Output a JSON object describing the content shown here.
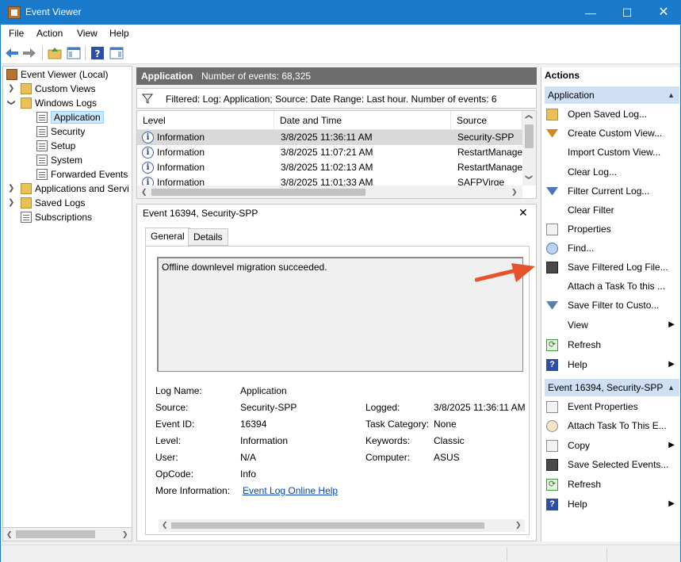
{
  "window": {
    "title": "Event Viewer"
  },
  "menu": [
    "File",
    "Action",
    "View",
    "Help"
  ],
  "tree": {
    "root": "Event Viewer (Local)",
    "custom_views": "Custom Views",
    "windows_logs": "Windows Logs",
    "logs": [
      "Application",
      "Security",
      "Setup",
      "System",
      "Forwarded Events"
    ],
    "apps_services": "Applications and Servi",
    "saved_logs": "Saved Logs",
    "subscriptions": "Subscriptions"
  },
  "center": {
    "log_name": "Application",
    "event_count": "Number of events: 68,325",
    "filter_text": "Filtered: Log: Application; Source: Date Range: Last hour. Number of events: 6",
    "columns": [
      "Level",
      "Date and Time",
      "Source"
    ],
    "rows": [
      {
        "level": "Information",
        "datetime": "3/8/2025 11:36:11 AM",
        "source": "Security-SPP"
      },
      {
        "level": "Information",
        "datetime": "3/8/2025 11:07:21 AM",
        "source": "RestartManage"
      },
      {
        "level": "Information",
        "datetime": "3/8/2025 11:02:13 AM",
        "source": "RestartManage"
      },
      {
        "level": "Information",
        "datetime": "3/8/2025 11:01:33 AM",
        "source": "SAFPVirge"
      }
    ]
  },
  "detail": {
    "header": "Event 16394, Security-SPP",
    "tabs": [
      "General",
      "Details"
    ],
    "message": "Offline downlevel migration succeeded.",
    "labels": {
      "log_name": "Log Name:",
      "source": "Source:",
      "event_id": "Event ID:",
      "level": "Level:",
      "user": "User:",
      "opcode": "OpCode:",
      "more_info": "More Information:",
      "logged": "Logged:",
      "task_category": "Task Category:",
      "keywords": "Keywords:",
      "computer": "Computer:"
    },
    "values": {
      "log_name": "Application",
      "source": "Security-SPP",
      "event_id": "16394",
      "level": "Information",
      "user": "N/A",
      "opcode": "Info",
      "more_info": "Event Log Online Help",
      "logged": "3/8/2025 11:36:11 AM",
      "task_category": "None",
      "keywords": "Classic",
      "computer": "ASUS"
    }
  },
  "actions": {
    "title": "Actions",
    "section1": "Application",
    "items1": [
      "Open Saved Log...",
      "Create Custom View...",
      "Import Custom View...",
      "Clear Log...",
      "Filter Current Log...",
      "Clear Filter",
      "Properties",
      "Find...",
      "Save Filtered Log File...",
      "Attach a Task To this ...",
      "Save Filter to Custo...",
      "View",
      "Refresh",
      "Help"
    ],
    "section2": "Event 16394, Security-SPP",
    "items2": [
      "Event Properties",
      "Attach Task To This E...",
      "Copy",
      "Save Selected Events...",
      "Refresh",
      "Help"
    ]
  }
}
